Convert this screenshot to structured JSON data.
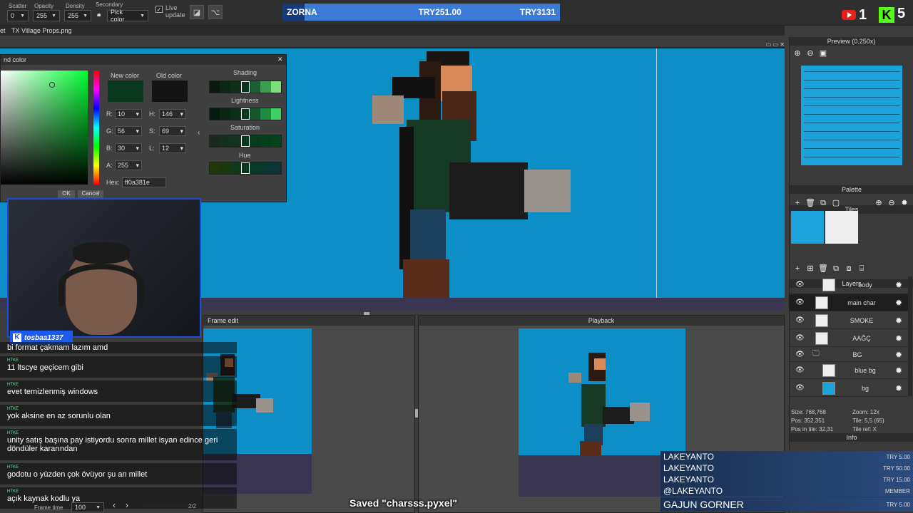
{
  "toolbar": {
    "scatter_label": "Scatter",
    "scatter_value": "0",
    "opacity_label": "Opacity",
    "opacity_value": "255",
    "density_label": "Density",
    "density_value": "255",
    "secondary_label": "Secondary",
    "secondary_value": "Pick color",
    "live_update_label_1": "Live",
    "live_update_label_2": "update"
  },
  "donation_goal": {
    "name": "ZORNA",
    "current": "TRY251.00",
    "target": "TRY3131",
    "progress": 0.08
  },
  "stream_counters": {
    "youtube_count": "1",
    "kick_count": "5"
  },
  "tabs": [
    {
      "label": "et"
    },
    {
      "label": "TX Village Props.png"
    }
  ],
  "color_dialog": {
    "title": "nd color",
    "new_color_label": "New color",
    "old_color_label": "Old color",
    "new_color": "#0a381e",
    "old_color": "#141414",
    "r_label": "R:",
    "r_value": "10",
    "g_label": "G:",
    "g_value": "56",
    "b_label": "B:",
    "b_value": "30",
    "a_label": "A:",
    "a_value": "255",
    "h_label": "H:",
    "h_value": "146",
    "s_label": "S:",
    "s_value": "69",
    "l_label": "L:",
    "l_value": "12",
    "hex_label": "Hex:",
    "hex_value": "ff0a381e",
    "shading_label": "Shading",
    "lightness_label": "Lightness",
    "saturation_label": "Saturation",
    "hue_label": "Hue",
    "ok_label": "OK",
    "cancel_label": "Cancel"
  },
  "right_panel": {
    "preview_title": "Preview (0.250x)",
    "palette_title": "Palette",
    "tiles_title": "Tiles",
    "layers_title": "Layers",
    "layers": [
      {
        "name": "body"
      },
      {
        "name": "main char"
      },
      {
        "name": "SMOKE"
      },
      {
        "name": "AAĞÇ"
      },
      {
        "name": "BG"
      },
      {
        "name": "blue bg"
      },
      {
        "name": "bg"
      }
    ],
    "info_title": "Info",
    "info": {
      "size": "Size: 768,768",
      "zoom": "Zoom: 12x",
      "pos": "Pos: 352,351",
      "tile": "Tile: 5,5 (65)",
      "pos_in_tile": "Pos in tile: 32,31",
      "tile_ref": "Tile ref: X"
    }
  },
  "frame_edit": {
    "title": "Frame edit",
    "frame_time_label": "Frame time",
    "frame_time_value": "100",
    "page": "2/2"
  },
  "playback": {
    "title": "Playback"
  },
  "webcam": {
    "username": "tosbaa1337"
  },
  "chat": [
    {
      "badge": "HTKE",
      "text": "bi format çakmam lazım amd"
    },
    {
      "badge": "HTKE",
      "text": "11 ltscye geçicem gibi"
    },
    {
      "badge": "HTKE",
      "text": "evet temizlenmiş windows"
    },
    {
      "badge": "HTKE",
      "text": "yok aksine en az sorunlu olan"
    },
    {
      "badge": "HTKE",
      "text": "unity satış başına pay istiyordu sonra millet isyan edince geri döndüler kararından"
    },
    {
      "badge": "HTKE",
      "text": "godotu o yüzden çok övüyor şu an millet"
    },
    {
      "badge": "HTKE",
      "text": "açık kaynak kodlu ya"
    }
  ],
  "donors": [
    {
      "name": "LAKEYANTO",
      "amount": "TRY 5.00"
    },
    {
      "name": "LAKEYANTO",
      "amount": "TRY 50.00"
    },
    {
      "name": "LAKEYANTO",
      "amount": "TRY 15.00"
    },
    {
      "name": "@LAKEYANTO",
      "amount": "MEMBER"
    },
    {
      "name": "GAJUN GORNER",
      "amount": "TRY 5.00"
    }
  ],
  "status_message": "Saved \"charsss.pyxel\"",
  "colors": {
    "canvas_bg": "#0b8fc6",
    "accent_blue": "#1c5bf0",
    "kick_green": "#53fc18"
  }
}
